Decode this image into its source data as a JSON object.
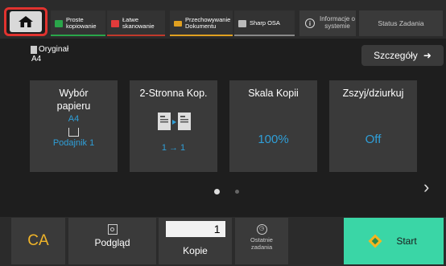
{
  "tabs": [
    {
      "label": "Proste kopiowanie",
      "icon": "copy-icon",
      "color": "#2aa64a"
    },
    {
      "label": "Łatwe skanowanie",
      "icon": "scan-icon",
      "color": "#c0392b"
    },
    {
      "label": "Przechowywanie Dokumentu",
      "icon": "folder-icon",
      "color": "#e0a020"
    },
    {
      "label": "Sharp OSA",
      "icon": "osa-icon",
      "color": "#888888"
    }
  ],
  "header": {
    "info_label": "Informacje o systemie",
    "status_label": "Status Zadania"
  },
  "original": {
    "label": "Oryginał",
    "value": "A4"
  },
  "details_label": "Szczegóły",
  "cards": [
    {
      "title": "Wybór papieru",
      "value": "A4",
      "sub": "Podajnik 1"
    },
    {
      "title": "2-Stronna Kop.",
      "sub": "1 → 1"
    },
    {
      "title": "Skala Kopii",
      "value": "100%"
    },
    {
      "title": "Zszyj/dziurkuj",
      "value": "Off"
    }
  ],
  "pager": {
    "pages": 2,
    "current": 1
  },
  "bottom": {
    "ca_label": "CA",
    "preview_label": "Podgląd",
    "copies_value": "1",
    "copies_label": "Kopie",
    "recent_label": "Ostatnie zadania",
    "start_label": "Start"
  },
  "colors": {
    "accent_blue": "#2f9fd8",
    "start_green": "#3ad6a6",
    "ca_yellow": "#f0b429",
    "home_border": "#e1332f"
  }
}
